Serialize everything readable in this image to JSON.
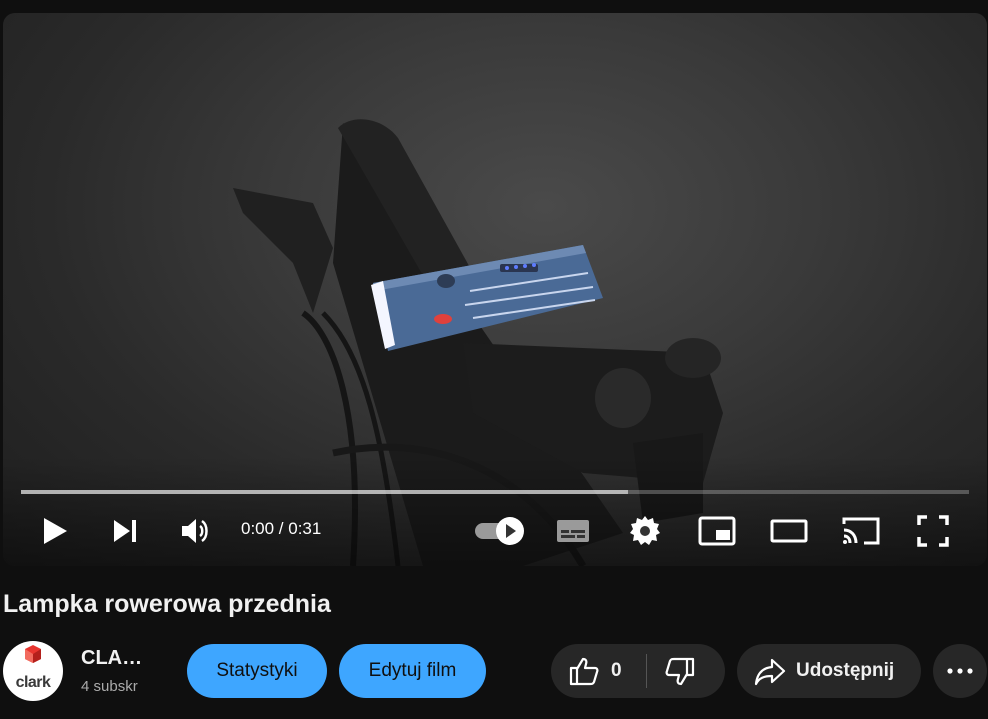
{
  "player": {
    "time_display": "0:00 / 0:31",
    "progress_fraction": 0,
    "buffered_fraction": 0.64
  },
  "video": {
    "title": "Lampka rowerowa przednia"
  },
  "channel": {
    "name": "CLA…",
    "subscribers": "4 subskr",
    "avatar_text": "clark"
  },
  "actions": {
    "stats_label": "Statystyki",
    "edit_label": "Edytuj film",
    "like_count": "0",
    "share_label": "Udostępnij"
  },
  "colors": {
    "accent_blue": "#3ea6ff",
    "background": "#0f0f0f",
    "pill": "#272727"
  },
  "icons": [
    "play-icon",
    "next-icon",
    "volume-icon",
    "autoplay-toggle-icon",
    "subtitles-icon",
    "settings-icon",
    "miniplayer-icon",
    "theater-icon",
    "cast-icon",
    "fullscreen-icon",
    "like-icon",
    "dislike-icon",
    "share-icon",
    "more-icon"
  ]
}
